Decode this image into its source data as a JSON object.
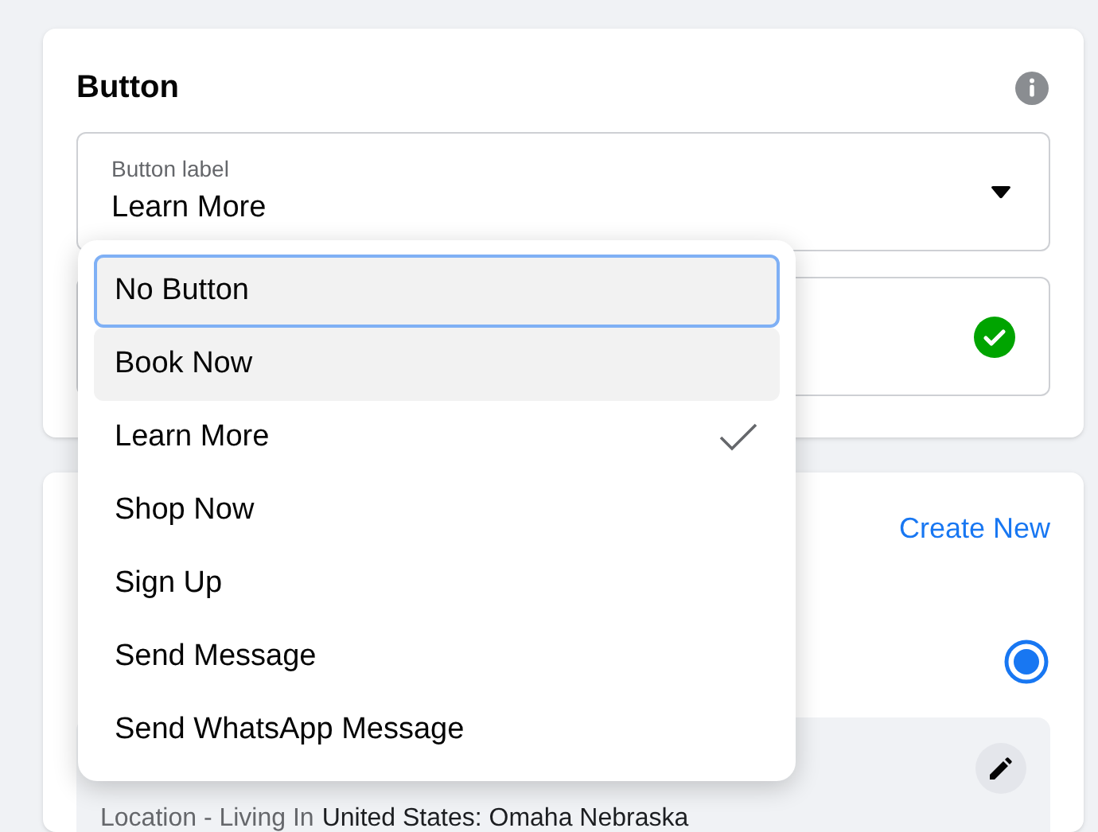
{
  "button_card": {
    "title": "Button",
    "field": {
      "label": "Button label",
      "value": "Learn More"
    },
    "second_field": {
      "valid": true
    }
  },
  "audience_card": {
    "link": "Create New",
    "radio": {
      "selected": true
    },
    "location": {
      "label": "Location - Living In",
      "value": "United States: Omaha Nebraska"
    }
  },
  "dropdown": {
    "items": [
      {
        "label": "No Button",
        "selected": false,
        "focused": true,
        "hovered": false
      },
      {
        "label": "Book Now",
        "selected": false,
        "focused": false,
        "hovered": true
      },
      {
        "label": "Learn More",
        "selected": true,
        "focused": false,
        "hovered": false
      },
      {
        "label": "Shop Now",
        "selected": false,
        "focused": false,
        "hovered": false
      },
      {
        "label": "Sign Up",
        "selected": false,
        "focused": false,
        "hovered": false
      },
      {
        "label": "Send Message",
        "selected": false,
        "focused": false,
        "hovered": false
      },
      {
        "label": "Send WhatsApp Message",
        "selected": false,
        "focused": false,
        "hovered": false
      }
    ]
  }
}
